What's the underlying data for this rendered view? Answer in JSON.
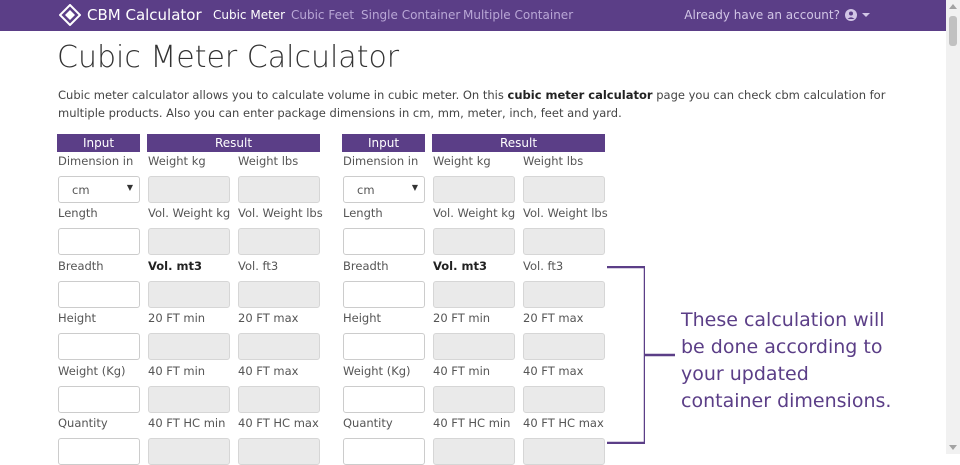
{
  "nav": {
    "brand": "CBM Calculator",
    "links": [
      "Cubic Meter",
      "Cubic Feet",
      "Single Container",
      "Multiple Container"
    ],
    "account": "Already have an account?"
  },
  "page": {
    "title": "Cubic Meter Calculator",
    "desc_1": "Cubic meter calculator allows you to calculate volume in cubic meter. On this ",
    "desc_bold": "cubic meter calculator",
    "desc_2": " page you can check cbm calculation for multiple products. Also you can enter package dimensions in cm, mm, meter, inch, feet and yard."
  },
  "calc": {
    "input_header": "Input",
    "result_header": "Result",
    "input_labels": [
      "Dimension in",
      "Length",
      "Breadth",
      "Height",
      "Weight (Kg)",
      "Quantity"
    ],
    "unit_value": "cm",
    "result_labels": [
      [
        "Weight kg",
        "Weight lbs"
      ],
      [
        "Vol. Weight kg",
        "Vol. Weight lbs"
      ],
      [
        "Vol. mt3",
        "Vol. ft3"
      ],
      [
        "20 FT min",
        "20 FT max"
      ],
      [
        "40 FT min",
        "40 FT max"
      ],
      [
        "40 FT HC min",
        "40 FT HC max"
      ]
    ]
  },
  "annotation": {
    "lines": [
      "These calculation will",
      "be done according to",
      "your updated",
      "container dimensions."
    ]
  },
  "colors": {
    "brand": "#5b3e87",
    "readonly": "#eaeaea"
  }
}
